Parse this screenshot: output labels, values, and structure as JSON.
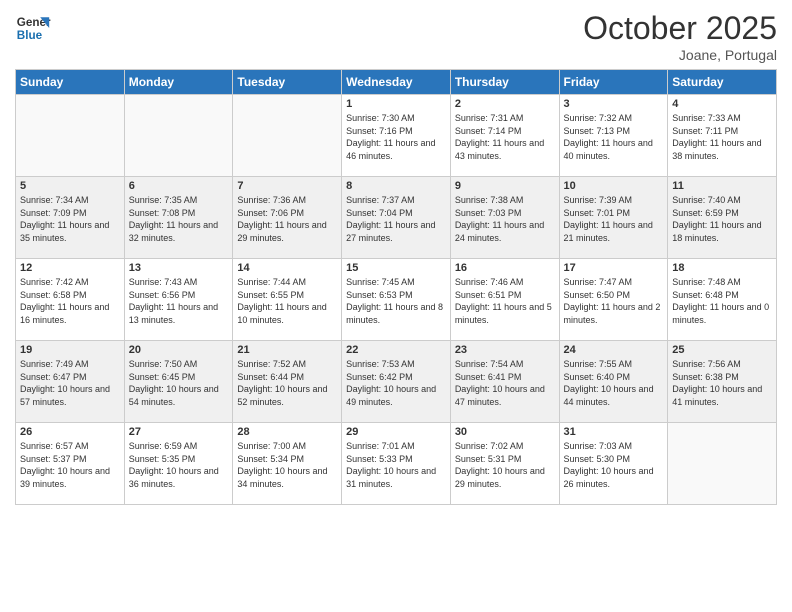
{
  "logo": {
    "line1": "General",
    "line2": "Blue"
  },
  "header": {
    "month": "October 2025",
    "location": "Joane, Portugal"
  },
  "weekdays": [
    "Sunday",
    "Monday",
    "Tuesday",
    "Wednesday",
    "Thursday",
    "Friday",
    "Saturday"
  ],
  "weeks": [
    [
      {
        "day": "",
        "sunrise": "",
        "sunset": "",
        "daylight": ""
      },
      {
        "day": "",
        "sunrise": "",
        "sunset": "",
        "daylight": ""
      },
      {
        "day": "",
        "sunrise": "",
        "sunset": "",
        "daylight": ""
      },
      {
        "day": "1",
        "sunrise": "Sunrise: 7:30 AM",
        "sunset": "Sunset: 7:16 PM",
        "daylight": "Daylight: 11 hours and 46 minutes."
      },
      {
        "day": "2",
        "sunrise": "Sunrise: 7:31 AM",
        "sunset": "Sunset: 7:14 PM",
        "daylight": "Daylight: 11 hours and 43 minutes."
      },
      {
        "day": "3",
        "sunrise": "Sunrise: 7:32 AM",
        "sunset": "Sunset: 7:13 PM",
        "daylight": "Daylight: 11 hours and 40 minutes."
      },
      {
        "day": "4",
        "sunrise": "Sunrise: 7:33 AM",
        "sunset": "Sunset: 7:11 PM",
        "daylight": "Daylight: 11 hours and 38 minutes."
      }
    ],
    [
      {
        "day": "5",
        "sunrise": "Sunrise: 7:34 AM",
        "sunset": "Sunset: 7:09 PM",
        "daylight": "Daylight: 11 hours and 35 minutes."
      },
      {
        "day": "6",
        "sunrise": "Sunrise: 7:35 AM",
        "sunset": "Sunset: 7:08 PM",
        "daylight": "Daylight: 11 hours and 32 minutes."
      },
      {
        "day": "7",
        "sunrise": "Sunrise: 7:36 AM",
        "sunset": "Sunset: 7:06 PM",
        "daylight": "Daylight: 11 hours and 29 minutes."
      },
      {
        "day": "8",
        "sunrise": "Sunrise: 7:37 AM",
        "sunset": "Sunset: 7:04 PM",
        "daylight": "Daylight: 11 hours and 27 minutes."
      },
      {
        "day": "9",
        "sunrise": "Sunrise: 7:38 AM",
        "sunset": "Sunset: 7:03 PM",
        "daylight": "Daylight: 11 hours and 24 minutes."
      },
      {
        "day": "10",
        "sunrise": "Sunrise: 7:39 AM",
        "sunset": "Sunset: 7:01 PM",
        "daylight": "Daylight: 11 hours and 21 minutes."
      },
      {
        "day": "11",
        "sunrise": "Sunrise: 7:40 AM",
        "sunset": "Sunset: 6:59 PM",
        "daylight": "Daylight: 11 hours and 18 minutes."
      }
    ],
    [
      {
        "day": "12",
        "sunrise": "Sunrise: 7:42 AM",
        "sunset": "Sunset: 6:58 PM",
        "daylight": "Daylight: 11 hours and 16 minutes."
      },
      {
        "day": "13",
        "sunrise": "Sunrise: 7:43 AM",
        "sunset": "Sunset: 6:56 PM",
        "daylight": "Daylight: 11 hours and 13 minutes."
      },
      {
        "day": "14",
        "sunrise": "Sunrise: 7:44 AM",
        "sunset": "Sunset: 6:55 PM",
        "daylight": "Daylight: 11 hours and 10 minutes."
      },
      {
        "day": "15",
        "sunrise": "Sunrise: 7:45 AM",
        "sunset": "Sunset: 6:53 PM",
        "daylight": "Daylight: 11 hours and 8 minutes."
      },
      {
        "day": "16",
        "sunrise": "Sunrise: 7:46 AM",
        "sunset": "Sunset: 6:51 PM",
        "daylight": "Daylight: 11 hours and 5 minutes."
      },
      {
        "day": "17",
        "sunrise": "Sunrise: 7:47 AM",
        "sunset": "Sunset: 6:50 PM",
        "daylight": "Daylight: 11 hours and 2 minutes."
      },
      {
        "day": "18",
        "sunrise": "Sunrise: 7:48 AM",
        "sunset": "Sunset: 6:48 PM",
        "daylight": "Daylight: 11 hours and 0 minutes."
      }
    ],
    [
      {
        "day": "19",
        "sunrise": "Sunrise: 7:49 AM",
        "sunset": "Sunset: 6:47 PM",
        "daylight": "Daylight: 10 hours and 57 minutes."
      },
      {
        "day": "20",
        "sunrise": "Sunrise: 7:50 AM",
        "sunset": "Sunset: 6:45 PM",
        "daylight": "Daylight: 10 hours and 54 minutes."
      },
      {
        "day": "21",
        "sunrise": "Sunrise: 7:52 AM",
        "sunset": "Sunset: 6:44 PM",
        "daylight": "Daylight: 10 hours and 52 minutes."
      },
      {
        "day": "22",
        "sunrise": "Sunrise: 7:53 AM",
        "sunset": "Sunset: 6:42 PM",
        "daylight": "Daylight: 10 hours and 49 minutes."
      },
      {
        "day": "23",
        "sunrise": "Sunrise: 7:54 AM",
        "sunset": "Sunset: 6:41 PM",
        "daylight": "Daylight: 10 hours and 47 minutes."
      },
      {
        "day": "24",
        "sunrise": "Sunrise: 7:55 AM",
        "sunset": "Sunset: 6:40 PM",
        "daylight": "Daylight: 10 hours and 44 minutes."
      },
      {
        "day": "25",
        "sunrise": "Sunrise: 7:56 AM",
        "sunset": "Sunset: 6:38 PM",
        "daylight": "Daylight: 10 hours and 41 minutes."
      }
    ],
    [
      {
        "day": "26",
        "sunrise": "Sunrise: 6:57 AM",
        "sunset": "Sunset: 5:37 PM",
        "daylight": "Daylight: 10 hours and 39 minutes."
      },
      {
        "day": "27",
        "sunrise": "Sunrise: 6:59 AM",
        "sunset": "Sunset: 5:35 PM",
        "daylight": "Daylight: 10 hours and 36 minutes."
      },
      {
        "day": "28",
        "sunrise": "Sunrise: 7:00 AM",
        "sunset": "Sunset: 5:34 PM",
        "daylight": "Daylight: 10 hours and 34 minutes."
      },
      {
        "day": "29",
        "sunrise": "Sunrise: 7:01 AM",
        "sunset": "Sunset: 5:33 PM",
        "daylight": "Daylight: 10 hours and 31 minutes."
      },
      {
        "day": "30",
        "sunrise": "Sunrise: 7:02 AM",
        "sunset": "Sunset: 5:31 PM",
        "daylight": "Daylight: 10 hours and 29 minutes."
      },
      {
        "day": "31",
        "sunrise": "Sunrise: 7:03 AM",
        "sunset": "Sunset: 5:30 PM",
        "daylight": "Daylight: 10 hours and 26 minutes."
      },
      {
        "day": "",
        "sunrise": "",
        "sunset": "",
        "daylight": ""
      }
    ]
  ]
}
